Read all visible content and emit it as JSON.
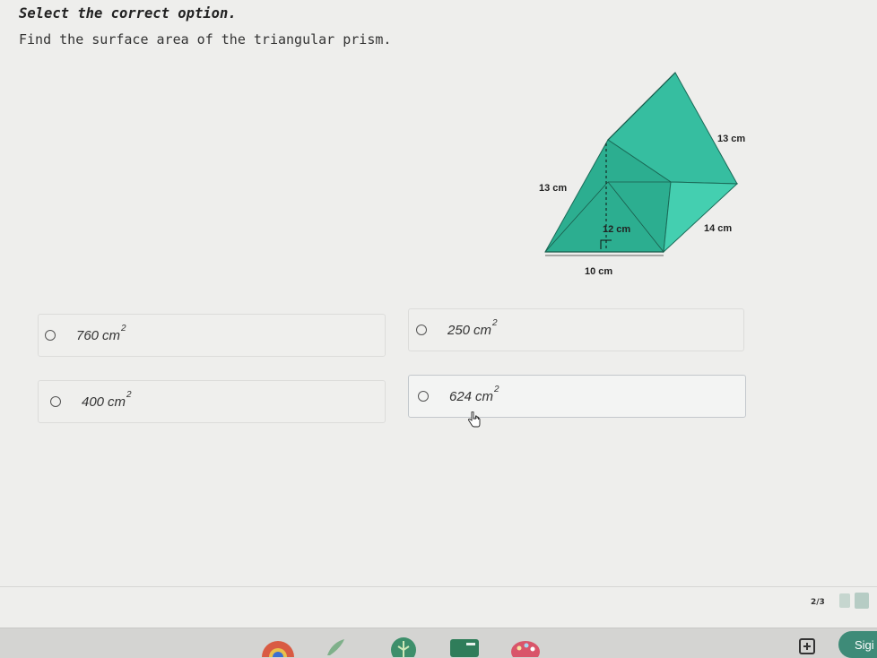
{
  "instruction": "Select the correct option.",
  "question": "Find the surface area of the triangular prism.",
  "figure": {
    "labels": {
      "slant_top": "13 cm",
      "slant_left": "13 cm",
      "height": "12 cm",
      "length": "14 cm",
      "base": "10 cm"
    },
    "colors": {
      "face_light": "#3fcaa8",
      "face_mid": "#2eb596",
      "face_dark": "#1f9c80",
      "edge": "#1a5a4a"
    }
  },
  "options": [
    {
      "value": "760",
      "unit": "cm",
      "exponent": "2"
    },
    {
      "value": "250",
      "unit": "cm",
      "exponent": "2"
    },
    {
      "value": "400",
      "unit": "cm",
      "exponent": "2"
    },
    {
      "value": "624",
      "unit": "cm",
      "exponent": "2"
    }
  ],
  "footer": {
    "progress": "2/3",
    "sign_label": "Sigi"
  },
  "colors": {
    "accent": "#3e8b78",
    "progress_box": "#b6ccc4"
  }
}
